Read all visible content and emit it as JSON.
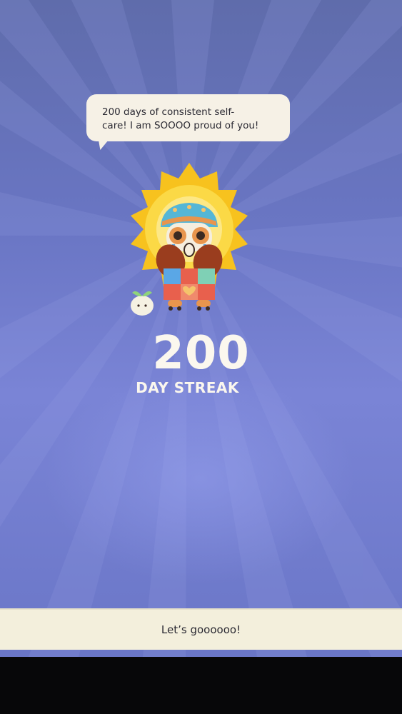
{
  "message": {
    "line1": "200 days of consistent self-",
    "line2": "care! I am SOOOO proud of you!"
  },
  "streak": {
    "count": "200",
    "label": "DAY STREAK"
  },
  "cta": {
    "label": "Let’s goooooo!"
  },
  "mascot": {
    "character": "sun-creature-crying-icon",
    "companion": "sprout-icon"
  },
  "colors": {
    "background": "#6a76c4",
    "bubble": "#f6f1e6",
    "sun": "#f7c21e",
    "text_light": "#fbf7ee",
    "cta_bg": "#f3efdc"
  }
}
